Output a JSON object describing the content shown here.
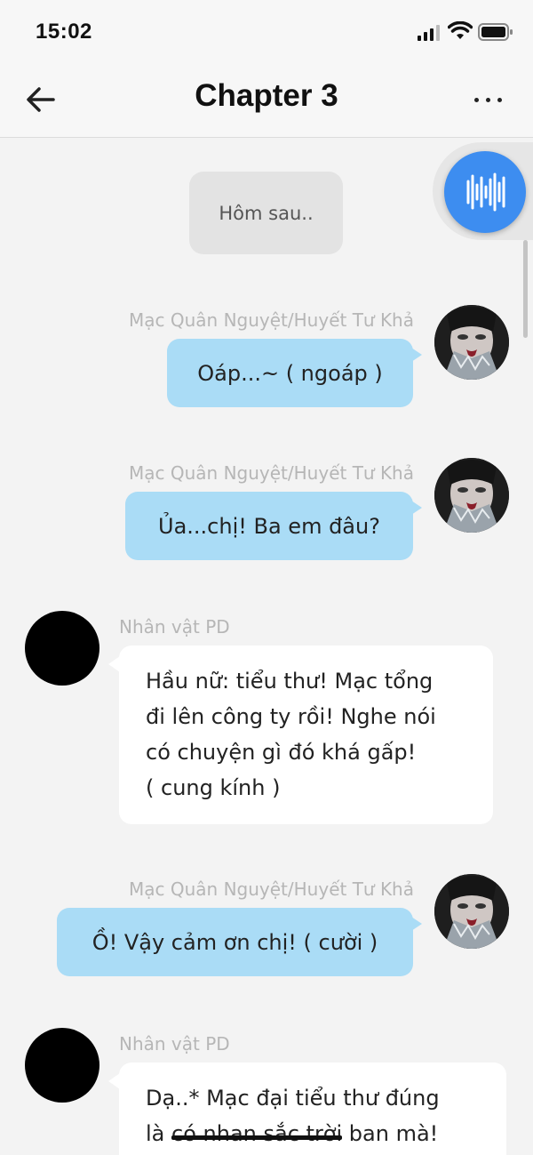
{
  "status_bar": {
    "time": "15:02"
  },
  "header": {
    "title": "Chapter 3"
  },
  "chat": {
    "narration": "Hôm sau..",
    "messages": [
      {
        "speaker": "Mạc Quân Nguyệt/Huyết Tư Khả",
        "text": "Oáp...~ ( ngoáp )"
      },
      {
        "speaker": "Mạc Quân Nguyệt/Huyết Tư Khả",
        "text": "Ủa...chị! Ba em đâu?"
      },
      {
        "speaker": "Nhân vật PD",
        "lines": [
          "Hầu nữ: tiểu thư! Mạc tổng",
          "đi lên công ty rồi! Nghe nói",
          "có chuyện gì đó khá gấp!",
          "( cung kính )"
        ]
      },
      {
        "speaker": "Mạc Quân Nguyệt/Huyết Tư Khả",
        "text": "Ồ! Vậy cảm ơn chị! ( cười )"
      },
      {
        "speaker": "Nhân vật PD",
        "line1": "Dạ..* Mạc đại tiểu thư đúng",
        "line2_start": "là ",
        "line2_struck": "có nhan sắc trời",
        "line2_end": " ban mà!"
      }
    ]
  },
  "colors": {
    "right_bubble": "#aadcf6",
    "left_bubble": "#ffffff",
    "voice_button": "#3d8df0",
    "background": "#f3f3f3"
  },
  "icons": [
    "back-arrow-icon",
    "more-options-icon",
    "voice-waveform-icon",
    "signal-icon",
    "wifi-icon",
    "battery-icon"
  ]
}
